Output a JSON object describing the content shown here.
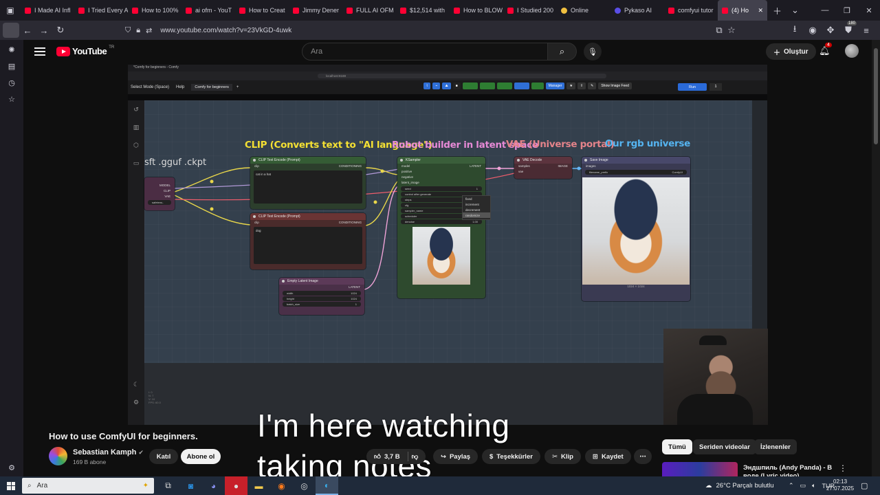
{
  "browser": {
    "tabs": [
      {
        "label": "I Made AI Infl",
        "icon": "youtube-icon"
      },
      {
        "label": "I Tried Every A",
        "icon": "youtube-icon"
      },
      {
        "label": "How to 100%",
        "icon": "youtube-icon"
      },
      {
        "label": "ai ofm - YouT",
        "icon": "youtube-icon"
      },
      {
        "label": "How to Creat",
        "icon": "youtube-icon"
      },
      {
        "label": "Jimmy Dener",
        "icon": "youtube-icon"
      },
      {
        "label": "FULL AI OFM",
        "icon": "youtube-icon"
      },
      {
        "label": "$12,514 with",
        "icon": "youtube-icon"
      },
      {
        "label": "How to BLOW",
        "icon": "youtube-icon"
      },
      {
        "label": "I Studied 200",
        "icon": "youtube-icon"
      },
      {
        "label": "Online",
        "icon": "emoji-icon"
      },
      {
        "label": "Pykaso AI",
        "icon": "pykaso-icon"
      },
      {
        "label": "comfyui tutor",
        "icon": "youtube-icon"
      },
      {
        "label": "(4) Ho",
        "icon": "youtube-icon",
        "active": true
      }
    ],
    "url": "www.youtube.com/watch?v=23VkGD-4uwk",
    "badge_count": "180"
  },
  "youtube": {
    "logo_text": "YouTube",
    "country_code": "TR",
    "search_placeholder": "Ara",
    "create_label": "Oluştur",
    "notif_count": "4"
  },
  "video": {
    "inner_app": {
      "menu_text": "Select Mode (Space)",
      "help_label": "Help",
      "tab_label": "Comfy for beginners",
      "url": "localhost:8188",
      "manager_label": "Manager",
      "show_image_feed": "Show Image Feed",
      "run_label": "Run",
      "run_count": "1"
    },
    "annotations": {
      "formats": "sft .gguf .ckpt",
      "clip": "CLIP (Converts text to \"AI language\")",
      "robot": "Robot builder in latent space",
      "vae": "VAE (Universe portal)",
      "rgb": "Our rgb universe"
    },
    "nodes": {
      "loader_outputs": [
        "MODEL",
        "CLIP",
        "VAE"
      ],
      "loader_widget": "safetens..",
      "clip_pos_title": "CLIP Text Encode (Prompt)",
      "clip_pos_text": "cat in a hat",
      "clip_neg_title": "CLIP Text Encode (Prompt)",
      "clip_neg_text": "dog",
      "clip_input": "clip",
      "clip_output": "CONDITIONING",
      "ksampler_title": "KSampler",
      "ksampler_inputs": [
        "model",
        "positive",
        "negative",
        "latent_image"
      ],
      "ksampler_output": "LATENT",
      "ksampler_widgets": [
        {
          "name": "seed",
          "value": "1"
        },
        {
          "name": "control after generate",
          "value": ""
        },
        {
          "name": "steps",
          "value": ""
        },
        {
          "name": "cfg",
          "value": ""
        },
        {
          "name": "sampler_name",
          "value": ""
        },
        {
          "name": "scheduler",
          "value": "normal"
        },
        {
          "name": "denoise",
          "value": "1.00"
        }
      ],
      "seed_menu": [
        "fixed",
        "increment",
        "decrement",
        "randomize"
      ],
      "latent_title": "Empty Latent Image",
      "latent_output": "LATENT",
      "latent_widgets": [
        {
          "name": "width",
          "value": "1024"
        },
        {
          "name": "height",
          "value": "1024"
        },
        {
          "name": "batch_size",
          "value": "1"
        }
      ],
      "vae_title": "VAE Decode",
      "vae_inputs": [
        "samples",
        "vae"
      ],
      "vae_output": "IMAGE",
      "save_title": "Save Image",
      "save_input": "images",
      "save_widget_name": "filename_prefix",
      "save_widget_value": "ComfyUI",
      "size_caption": "1024 × 1024"
    },
    "subtitles": [
      "I'm here watching",
      "taking notes"
    ]
  },
  "below": {
    "title": "How to use ComfyUI for beginners.",
    "channel": "Sebastian Kamph",
    "subscribers": "169 B abone",
    "join_label": "Katıl",
    "subscribe_label": "Abone ol",
    "likes": "3,7 B",
    "share_label": "Paylaş",
    "thanks_label": "Teşekkürler",
    "clip_label": "Klip",
    "save_label": "Kaydet",
    "chips": [
      "Tümü",
      "Seriden videolar",
      "İzlenenler"
    ],
    "rec_title": "Эндшпиль (Andy Panda) - В воде (Lyric video)"
  },
  "taskbar": {
    "search_placeholder": "Ara",
    "weather": "26°C  Parçalı bulutlu",
    "lang": "TUR",
    "time": "02:13",
    "date": "27.07.2025"
  }
}
